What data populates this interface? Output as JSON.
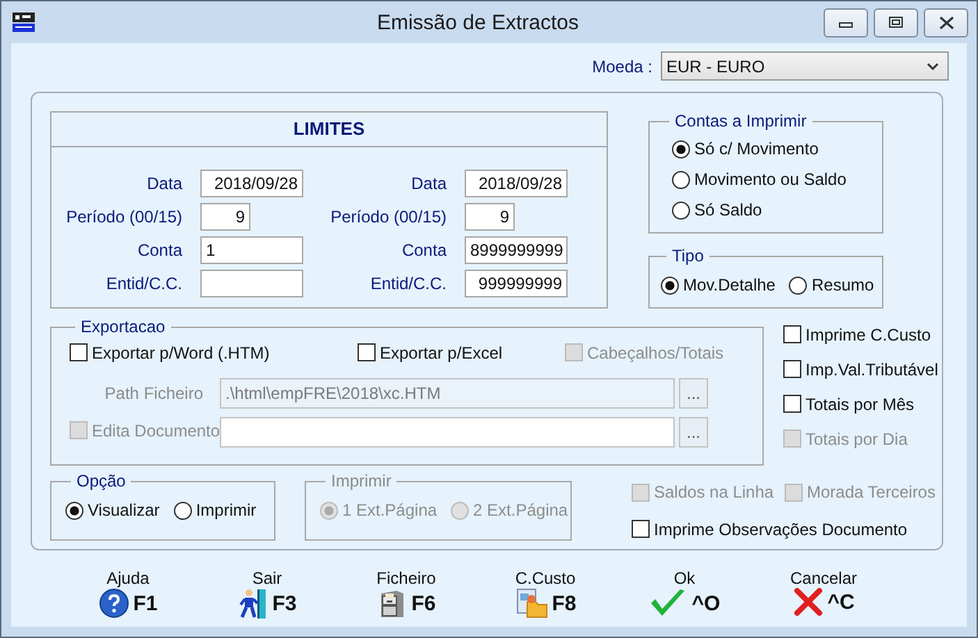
{
  "window": {
    "title": "Emissão de Extractos"
  },
  "currency": {
    "label": "Moeda :",
    "value": "EUR - EURO"
  },
  "limits": {
    "title": "LIMITES",
    "columns": [
      {
        "fields": [
          {
            "kind": "date",
            "label": "Data",
            "value": "2018/09/28"
          },
          {
            "kind": "period",
            "label": "Período (00/15)",
            "value": "9"
          },
          {
            "kind": "account",
            "label": "Conta",
            "value": "1"
          },
          {
            "kind": "entity",
            "label": "Entid/C.C."
          }
        ]
      },
      {
        "fields": [
          {
            "kind": "date",
            "label": "Data",
            "value": "2018/09/28"
          },
          {
            "kind": "period",
            "label": "Período (00/15)",
            "value": "9"
          },
          {
            "kind": "account",
            "label": "Conta",
            "value": "8999999999"
          },
          {
            "kind": "entity",
            "label": "Entid/C.C.",
            "value": "999999999"
          }
        ]
      }
    ]
  },
  "accounts_to_print": {
    "title": "Contas a Imprimir",
    "options": [
      {
        "label": "Só c/ Movimento",
        "selected": true
      },
      {
        "label": "Movimento ou Saldo",
        "selected": false
      },
      {
        "label": "Só Saldo",
        "selected": false
      }
    ]
  },
  "type": {
    "title": "Tipo",
    "options": [
      {
        "label": "Mov.Detalhe",
        "selected": true
      },
      {
        "label": "Resumo",
        "selected": false
      }
    ]
  },
  "export": {
    "title": "Exportacao",
    "checks": [
      {
        "label": "Exportar p/Word (.HTM)",
        "checked": false,
        "disabled": false
      },
      {
        "label": "Exportar p/Excel",
        "checked": false,
        "disabled": false
      },
      {
        "label": "Cabeçalhos/Totais",
        "checked": false,
        "disabled": true
      }
    ],
    "path": {
      "label": "Path Ficheiro",
      "value": ".\\html\\empFRE\\2018\\xc.HTM",
      "disabled": true,
      "button": "..."
    },
    "edit_document": {
      "label": "Edita Documento",
      "checked": false,
      "disabled": true,
      "button": "..."
    }
  },
  "side_checks": [
    {
      "label": "Imprime C.Custo",
      "checked": false,
      "disabled": false
    },
    {
      "label": "Imp.Val.Tributável",
      "checked": false,
      "disabled": false
    },
    {
      "label": "Totais por Mês",
      "checked": false,
      "disabled": false
    },
    {
      "label": "Totais por Dia",
      "checked": false,
      "disabled": true
    }
  ],
  "option": {
    "title": "Opção",
    "options": [
      {
        "label": "Visualizar",
        "selected": true
      },
      {
        "label": "Imprimir",
        "selected": false
      }
    ]
  },
  "print": {
    "title": "Imprimir",
    "disabled": true,
    "options": [
      {
        "label": "1 Ext.Página",
        "selected": true
      },
      {
        "label": "2 Ext.Página",
        "selected": false
      }
    ]
  },
  "extra_checks": [
    {
      "label": "Saldos na Linha",
      "checked": false,
      "disabled": true
    },
    {
      "label": "Morada Terceiros",
      "checked": false,
      "disabled": true
    },
    {
      "label": "Imprime Observações Documento",
      "checked": false,
      "disabled": false
    }
  ],
  "toolbar": [
    {
      "kind": "help",
      "label": "Ajuda",
      "key": "F1"
    },
    {
      "kind": "exit",
      "label": "Sair",
      "key": "F3"
    },
    {
      "kind": "file",
      "label": "Ficheiro",
      "key": "F6"
    },
    {
      "kind": "cost",
      "label": "C.Custo",
      "key": "F8"
    },
    {
      "kind": "ok",
      "label": "Ok",
      "key": "^O"
    },
    {
      "kind": "cancel",
      "label": "Cancelar",
      "key": "^C"
    }
  ]
}
